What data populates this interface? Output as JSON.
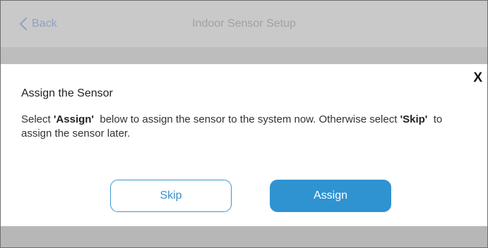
{
  "header": {
    "back_label": "Back",
    "title": "Indoor Sensor Setup"
  },
  "dialog": {
    "close_label": "X",
    "title": "Assign the Sensor",
    "body": {
      "part1": "Select ",
      "assign_ref": "'Assign'",
      "part2": "  below to assign the sensor to the system now. Otherwise select ",
      "skip_ref": "'Skip'",
      "part3": "  to assign the sensor later."
    },
    "skip_label": "Skip",
    "assign_label": "Assign"
  },
  "icons": {
    "back": "chevron-left-icon"
  },
  "colors": {
    "accent": "#2f93d1",
    "header_bg": "#c9c9c9",
    "back_text": "#8ea1c4",
    "overlay": "#b7b7b7"
  }
}
